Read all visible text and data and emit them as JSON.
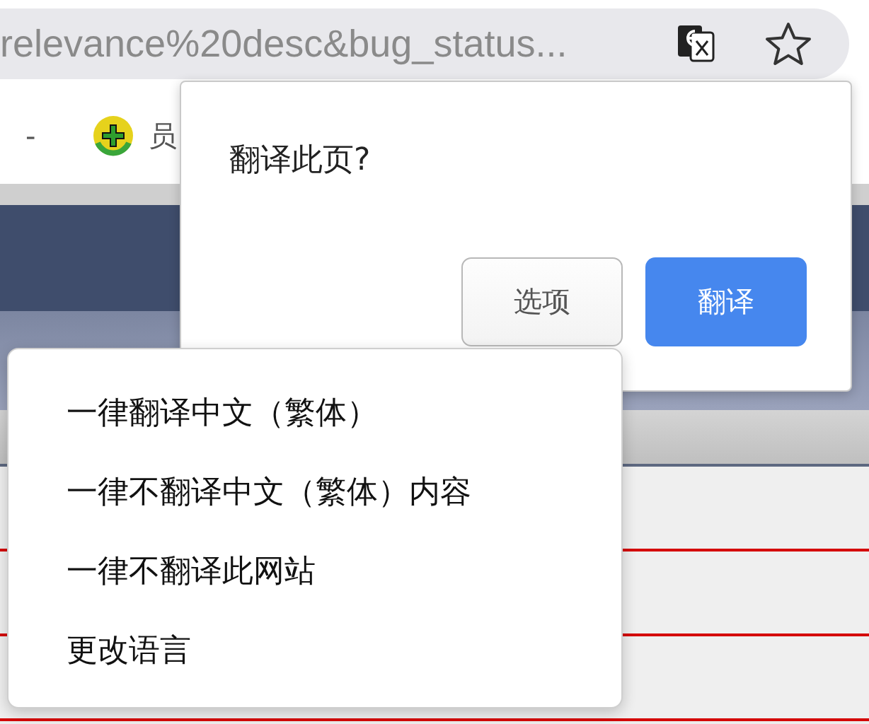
{
  "address_bar": {
    "url": "relevance%20desc&bug_status..."
  },
  "bookmarks": [
    {
      "label": "-"
    },
    {
      "label": "员"
    }
  ],
  "translate_dialog": {
    "title": "翻译此页?",
    "buttons": [
      {
        "label": "选项",
        "kind": "secondary"
      },
      {
        "label": "翻译",
        "kind": "primary"
      }
    ]
  },
  "options_menu": {
    "items": [
      {
        "label": "一律翻译中文（繁体）"
      },
      {
        "label": "一律不翻译中文（繁体）内容"
      },
      {
        "label": "一律不翻译此网站"
      },
      {
        "label": "更改语言"
      }
    ]
  }
}
